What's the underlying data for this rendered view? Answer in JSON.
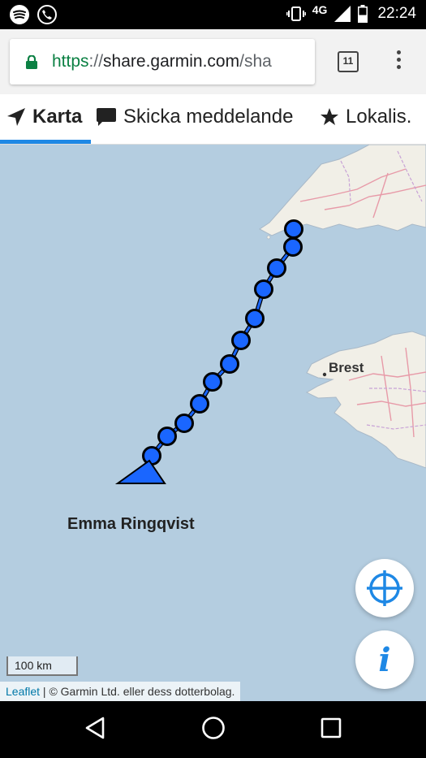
{
  "statusbar": {
    "network": "4G",
    "time": "22:24",
    "icons": [
      "spotify-icon",
      "phone-icon",
      "vibrate-icon",
      "signal-icon",
      "battery-icon"
    ]
  },
  "browser": {
    "url_scheme": "https",
    "url_sep": "://",
    "url_host": "share.garmin.com",
    "url_path": "/sha",
    "tab_count": "11"
  },
  "tabs": [
    {
      "label": "Karta",
      "icon": "navigation-arrow-icon",
      "active": true
    },
    {
      "label": "Skicka meddelande",
      "icon": "message-icon",
      "active": false
    },
    {
      "label": "Lokalis.",
      "icon": "star-icon",
      "active": false
    }
  ],
  "map": {
    "place_label": "Brest",
    "tracker_name": "Emma Ringqvist",
    "scale_label": "100 km",
    "attribution_link": "Leaflet",
    "attribution_text": " | © Garmin Ltd. eller dess dotterbolag.",
    "track_color": "#1a66ff",
    "water_color": "#b4cde0",
    "land_color": "#f1efe7"
  },
  "navbar": {
    "buttons": [
      "back-icon",
      "home-icon",
      "recents-icon"
    ]
  }
}
